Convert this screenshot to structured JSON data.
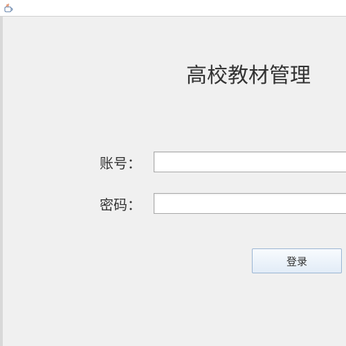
{
  "window": {
    "icon": "java-cup-icon"
  },
  "app": {
    "title": "高校教材管理"
  },
  "form": {
    "account": {
      "label": "账号：",
      "value": ""
    },
    "password": {
      "label": "密码：",
      "value": ""
    },
    "login_button_label": "登录"
  }
}
